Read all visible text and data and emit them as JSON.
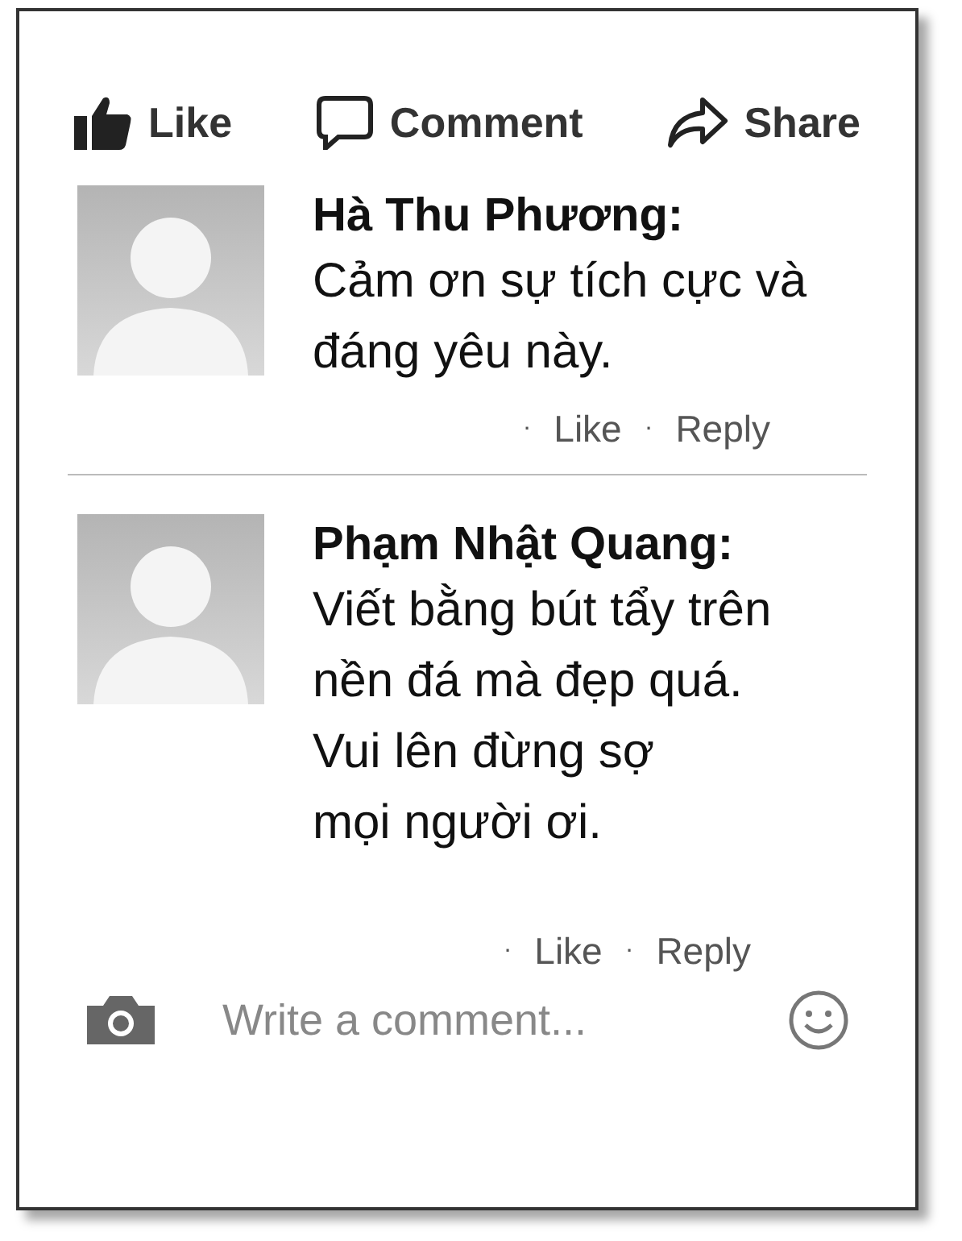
{
  "actions": [
    {
      "kind": "like",
      "label": "Like"
    },
    {
      "kind": "comment",
      "label": "Comment"
    },
    {
      "kind": "share",
      "label": "Share"
    }
  ],
  "comments": [
    {
      "author": "Hà Thu Phương:",
      "lines": [
        "Cảm ơn sự tích cực và",
        "đáng yêu này."
      ],
      "links": [
        {
          "bullet": "·",
          "label": "Like"
        },
        {
          "bullet": "·",
          "label": "Reply"
        }
      ]
    },
    {
      "author": "Phạm Nhật Quang:",
      "lines": [
        "Viết bằng bút tẩy trên",
        "nền đá mà đẹp quá.",
        "Vui lên đừng sợ",
        "mọi người ơi."
      ],
      "links": [
        {
          "bullet": "·",
          "label": "Like"
        },
        {
          "bullet": "·",
          "label": "Reply"
        }
      ]
    }
  ],
  "composer": {
    "placeholder": "Write a comment..."
  }
}
